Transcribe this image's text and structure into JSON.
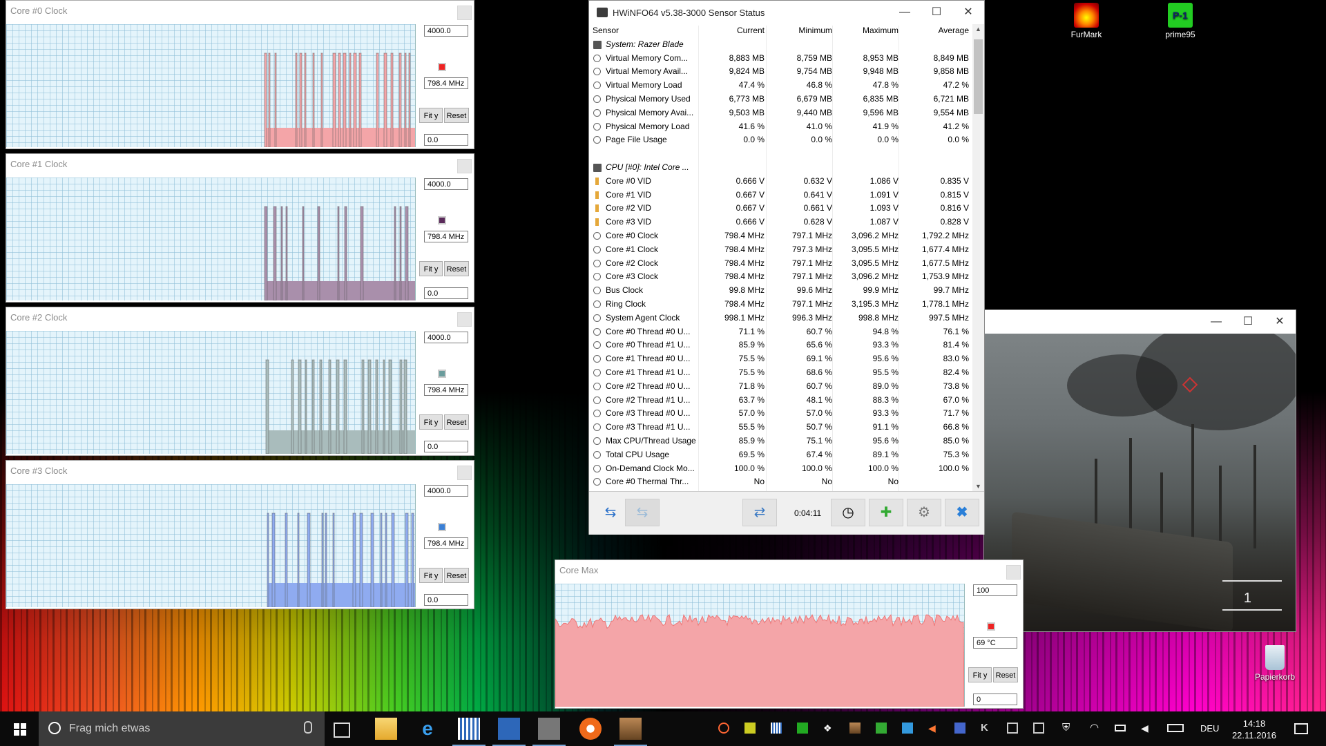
{
  "desktop": {
    "icons": [
      {
        "label": "FurMark",
        "icon": "furmark-icon"
      },
      {
        "label": "prime95",
        "icon": "prime95-icon"
      },
      {
        "label": "Papierkorb",
        "icon": "recycle-bin-icon"
      }
    ]
  },
  "graphs": [
    {
      "title": "Core #0 Clock",
      "max": "4000.0",
      "current": "798.4 MHz",
      "min": "0.0",
      "color": "#f4a5a8",
      "fit_label": "Fit y",
      "reset_label": "Reset"
    },
    {
      "title": "Core #1 Clock",
      "max": "4000.0",
      "current": "798.4 MHz",
      "min": "0.0",
      "color": "#a98fab",
      "fit_label": "Fit y",
      "reset_label": "Reset"
    },
    {
      "title": "Core #2 Clock",
      "max": "4000.0",
      "current": "798.4 MHz",
      "min": "0.0",
      "color": "#a9bcbc",
      "fit_label": "Fit y",
      "reset_label": "Reset"
    },
    {
      "title": "Core #3 Clock",
      "max": "4000.0",
      "current": "798.4 MHz",
      "min": "0.0",
      "color": "#8fabf0",
      "fit_label": "Fit y",
      "reset_label": "Reset"
    },
    {
      "title": "Core Max",
      "max": "100",
      "current": "69 °C",
      "min": "0",
      "color": "#f4a5a8",
      "fit_label": "Fit y",
      "reset_label": "Reset"
    }
  ],
  "hwinfo": {
    "title": "HWiNFO64 v5.38-3000 Sensor Status",
    "columns": [
      "Sensor",
      "Current",
      "Minimum",
      "Maximum",
      "Average"
    ],
    "rows": [
      {
        "type": "group",
        "name": "System: Razer Blade"
      },
      {
        "type": "sensor",
        "name": "Virtual Memory Com...",
        "cur": "8,883 MB",
        "min": "8,759 MB",
        "max": "8,953 MB",
        "avg": "8,849 MB"
      },
      {
        "type": "sensor",
        "name": "Virtual Memory Avail...",
        "cur": "9,824 MB",
        "min": "9,754 MB",
        "max": "9,948 MB",
        "avg": "9,858 MB"
      },
      {
        "type": "sensor",
        "name": "Virtual Memory Load",
        "cur": "47.4 %",
        "min": "46.8 %",
        "max": "47.8 %",
        "avg": "47.2 %"
      },
      {
        "type": "sensor",
        "name": "Physical Memory Used",
        "cur": "6,773 MB",
        "min": "6,679 MB",
        "max": "6,835 MB",
        "avg": "6,721 MB"
      },
      {
        "type": "sensor",
        "name": "Physical Memory Avai...",
        "cur": "9,503 MB",
        "min": "9,440 MB",
        "max": "9,596 MB",
        "avg": "9,554 MB"
      },
      {
        "type": "sensor",
        "name": "Physical Memory Load",
        "cur": "41.6 %",
        "min": "41.0 %",
        "max": "41.9 %",
        "avg": "41.2 %"
      },
      {
        "type": "sensor",
        "name": "Page File Usage",
        "cur": "0.0 %",
        "min": "0.0 %",
        "max": "0.0 %",
        "avg": "0.0 %"
      },
      {
        "type": "blank",
        "name": ""
      },
      {
        "type": "group",
        "name": "CPU [#0]: Intel Core ..."
      },
      {
        "type": "volt",
        "name": "Core #0 VID",
        "cur": "0.666 V",
        "min": "0.632 V",
        "max": "1.086 V",
        "avg": "0.835 V"
      },
      {
        "type": "volt",
        "name": "Core #1 VID",
        "cur": "0.667 V",
        "min": "0.641 V",
        "max": "1.091 V",
        "avg": "0.815 V"
      },
      {
        "type": "volt",
        "name": "Core #2 VID",
        "cur": "0.667 V",
        "min": "0.661 V",
        "max": "1.093 V",
        "avg": "0.816 V"
      },
      {
        "type": "volt",
        "name": "Core #3 VID",
        "cur": "0.666 V",
        "min": "0.628 V",
        "max": "1.087 V",
        "avg": "0.828 V"
      },
      {
        "type": "sensor",
        "name": "Core #0 Clock",
        "cur": "798.4 MHz",
        "min": "797.1 MHz",
        "max": "3,096.2 MHz",
        "avg": "1,792.2 MHz"
      },
      {
        "type": "sensor",
        "name": "Core #1 Clock",
        "cur": "798.4 MHz",
        "min": "797.3 MHz",
        "max": "3,095.5 MHz",
        "avg": "1,677.4 MHz"
      },
      {
        "type": "sensor",
        "name": "Core #2 Clock",
        "cur": "798.4 MHz",
        "min": "797.1 MHz",
        "max": "3,095.5 MHz",
        "avg": "1,677.5 MHz"
      },
      {
        "type": "sensor",
        "name": "Core #3 Clock",
        "cur": "798.4 MHz",
        "min": "797.1 MHz",
        "max": "3,096.2 MHz",
        "avg": "1,753.9 MHz"
      },
      {
        "type": "sensor",
        "name": "Bus Clock",
        "cur": "99.8 MHz",
        "min": "99.6 MHz",
        "max": "99.9 MHz",
        "avg": "99.7 MHz"
      },
      {
        "type": "sensor",
        "name": "Ring Clock",
        "cur": "798.4 MHz",
        "min": "797.1 MHz",
        "max": "3,195.3 MHz",
        "avg": "1,778.1 MHz"
      },
      {
        "type": "sensor",
        "name": "System Agent Clock",
        "cur": "998.1 MHz",
        "min": "996.3 MHz",
        "max": "998.8 MHz",
        "avg": "997.5 MHz"
      },
      {
        "type": "sensor",
        "name": "Core #0 Thread #0 U...",
        "cur": "71.1 %",
        "min": "60.7 %",
        "max": "94.8 %",
        "avg": "76.1 %"
      },
      {
        "type": "sensor",
        "name": "Core #0 Thread #1 U...",
        "cur": "85.9 %",
        "min": "65.6 %",
        "max": "93.3 %",
        "avg": "81.4 %"
      },
      {
        "type": "sensor",
        "name": "Core #1 Thread #0 U...",
        "cur": "75.5 %",
        "min": "69.1 %",
        "max": "95.6 %",
        "avg": "83.0 %"
      },
      {
        "type": "sensor",
        "name": "Core #1 Thread #1 U...",
        "cur": "75.5 %",
        "min": "68.6 %",
        "max": "95.5 %",
        "avg": "82.4 %"
      },
      {
        "type": "sensor",
        "name": "Core #2 Thread #0 U...",
        "cur": "71.8 %",
        "min": "60.7 %",
        "max": "89.0 %",
        "avg": "73.8 %"
      },
      {
        "type": "sensor",
        "name": "Core #2 Thread #1 U...",
        "cur": "63.7 %",
        "min": "48.1 %",
        "max": "88.3 %",
        "avg": "67.0 %"
      },
      {
        "type": "sensor",
        "name": "Core #3 Thread #0 U...",
        "cur": "57.0 %",
        "min": "57.0 %",
        "max": "93.3 %",
        "avg": "71.7 %"
      },
      {
        "type": "sensor",
        "name": "Core #3 Thread #1 U...",
        "cur": "55.5 %",
        "min": "50.7 %",
        "max": "91.1 %",
        "avg": "66.8 %"
      },
      {
        "type": "sensor",
        "name": "Max CPU/Thread Usage",
        "cur": "85.9 %",
        "min": "75.1 %",
        "max": "95.6 %",
        "avg": "85.0 %"
      },
      {
        "type": "sensor",
        "name": "Total CPU Usage",
        "cur": "69.5 %",
        "min": "67.4 %",
        "max": "89.1 %",
        "avg": "75.3 %"
      },
      {
        "type": "sensor",
        "name": "On-Demand Clock Mo...",
        "cur": "100.0 %",
        "min": "100.0 %",
        "max": "100.0 %",
        "avg": "100.0 %"
      },
      {
        "type": "sensor",
        "name": "Core #0 Thermal Thr...",
        "cur": "No",
        "min": "No",
        "max": "No",
        "avg": ""
      }
    ],
    "elapsed": "0:04:11"
  },
  "game": {
    "hud_number": "1"
  },
  "taskbar": {
    "search_placeholder": "Frag mich etwas",
    "language": "DEU",
    "time": "14:18",
    "date": "22.11.2016"
  }
}
